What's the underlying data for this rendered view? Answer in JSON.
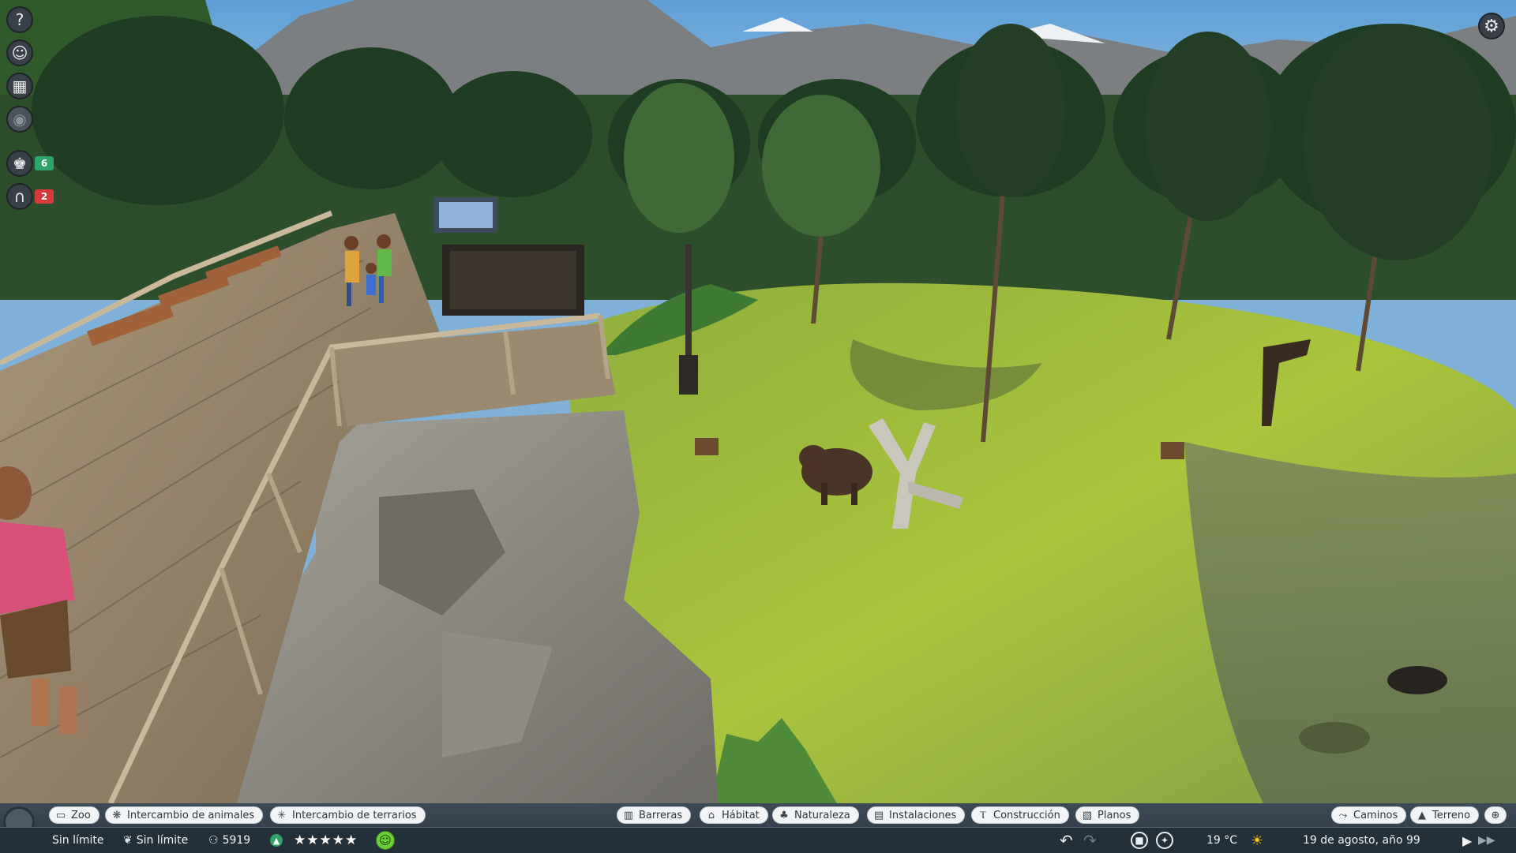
{
  "left_toolbar": {
    "help_icon": "question-icon",
    "animals_icon": "animal-face-icon",
    "calendar_icon": "calendar-icon",
    "hidden_icon": "eye-icon",
    "staff_count": "6",
    "guests_count": "2",
    "staff_badge_color": "#2ea36a",
    "guests_badge_color": "#d63a3a"
  },
  "toolbar": {
    "zoo": "Zoo",
    "animal_trade": "Intercambio de animales",
    "terrarium_trade": "Intercambio de terrarios",
    "barriers": "Barreras",
    "habitat": "Hábitat",
    "nature": "Naturaleza",
    "facilities": "Instalaciones",
    "construction": "Construcción",
    "blueprints": "Planos",
    "paths": "Caminos",
    "terrain": "Terreno"
  },
  "status": {
    "money": "Sin límite",
    "research": "Sin límite",
    "guests": "5919",
    "rating_stars": "★★★★★",
    "temperature": "19 °C",
    "date": "19 de agosto, año 99",
    "weather_icon": "sun-icon"
  },
  "colors": {
    "bar_bg": "#2c3640",
    "pill_bg": "#f1f3f5",
    "accent_green": "#2ea36a",
    "accent_red": "#d63a3a"
  }
}
